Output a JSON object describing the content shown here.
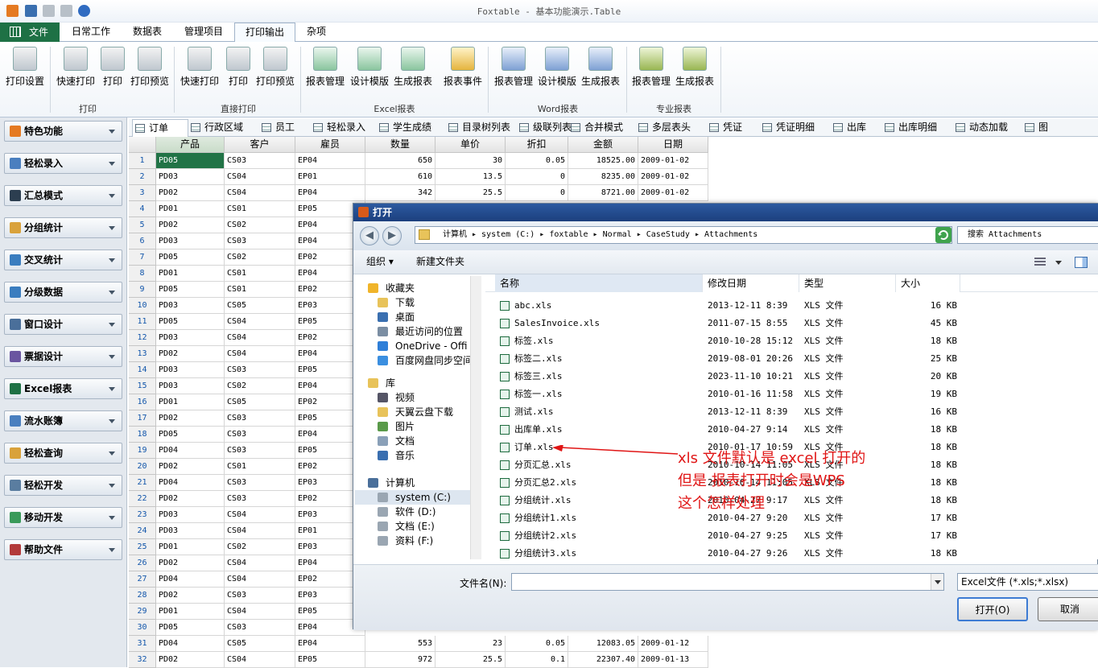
{
  "app": {
    "title": "Foxtable - 基本功能演示.Table"
  },
  "ribbon_tabs": {
    "file": "文件",
    "items": [
      "日常工作",
      "数据表",
      "管理项目",
      "打印输出",
      "杂项"
    ],
    "active": "打印输出"
  },
  "ribbon": {
    "buttons": [
      "打印设置",
      "快速打印",
      "打印",
      "打印预览",
      "快速打印",
      "打印",
      "打印预览",
      "报表管理",
      "设计模版",
      "生成报表",
      "报表事件",
      "报表管理",
      "设计模版",
      "生成报表",
      "报表管理",
      "生成报表"
    ],
    "groups": [
      "打印",
      "直接打印",
      "Excel报表",
      "Word报表",
      "专业报表"
    ]
  },
  "sidebar": {
    "items": [
      "特色功能",
      "轻松录入",
      "汇总模式",
      "分组统计",
      "交叉统计",
      "分级数据",
      "窗口设计",
      "票据设计",
      "Excel报表",
      "流水账簿",
      "轻松查询",
      "轻松开发",
      "移动开发",
      "帮助文件"
    ]
  },
  "doc_tabs": [
    "订单",
    "行政区域",
    "员工",
    "轻松录入",
    "学生成绩",
    "目录树列表",
    "级联列表",
    "合并模式",
    "多层表头",
    "凭证",
    "凭证明细",
    "出库",
    "出库明细",
    "动态加载",
    "图"
  ],
  "grid": {
    "columns": [
      "产品",
      "客户",
      "雇员",
      "数量",
      "单价",
      "折扣",
      "金额",
      "日期"
    ],
    "rows": [
      [
        "1",
        "PD05",
        "CS03",
        "EP04",
        "650",
        "30",
        "0.05",
        "18525.00",
        "2009-01-02"
      ],
      [
        "2",
        "PD03",
        "CS04",
        "EP01",
        "610",
        "13.5",
        "0",
        "8235.00",
        "2009-01-02"
      ],
      [
        "3",
        "PD02",
        "CS04",
        "EP04",
        "342",
        "25.5",
        "0",
        "8721.00",
        "2009-01-02"
      ],
      [
        "4",
        "PD01",
        "CS01",
        "EP05"
      ],
      [
        "5",
        "PD02",
        "CS02",
        "EP04"
      ],
      [
        "6",
        "PD03",
        "CS03",
        "EP04"
      ],
      [
        "7",
        "PD05",
        "CS02",
        "EP02"
      ],
      [
        "8",
        "PD01",
        "CS01",
        "EP04"
      ],
      [
        "9",
        "PD05",
        "CS01",
        "EP02"
      ],
      [
        "10",
        "PD03",
        "CS05",
        "EP03"
      ],
      [
        "11",
        "PD05",
        "CS04",
        "EP05"
      ],
      [
        "12",
        "PD03",
        "CS04",
        "EP02"
      ],
      [
        "13",
        "PD02",
        "CS04",
        "EP04"
      ],
      [
        "14",
        "PD03",
        "CS03",
        "EP05"
      ],
      [
        "15",
        "PD03",
        "CS02",
        "EP04"
      ],
      [
        "16",
        "PD01",
        "CS05",
        "EP02"
      ],
      [
        "17",
        "PD02",
        "CS03",
        "EP05"
      ],
      [
        "18",
        "PD05",
        "CS03",
        "EP04"
      ],
      [
        "19",
        "PD04",
        "CS03",
        "EP05"
      ],
      [
        "20",
        "PD02",
        "CS01",
        "EP02"
      ],
      [
        "21",
        "PD04",
        "CS03",
        "EP03"
      ],
      [
        "22",
        "PD02",
        "CS03",
        "EP02"
      ],
      [
        "23",
        "PD03",
        "CS04",
        "EP03"
      ],
      [
        "24",
        "PD03",
        "CS04",
        "EP01"
      ],
      [
        "25",
        "PD01",
        "CS02",
        "EP03"
      ],
      [
        "26",
        "PD02",
        "CS04",
        "EP04"
      ],
      [
        "27",
        "PD04",
        "CS04",
        "EP02"
      ],
      [
        "28",
        "PD02",
        "CS03",
        "EP03"
      ],
      [
        "29",
        "PD01",
        "CS04",
        "EP05"
      ],
      [
        "30",
        "PD05",
        "CS03",
        "EP04"
      ],
      [
        "31",
        "PD04",
        "CS05",
        "EP04",
        "553",
        "23",
        "0.05",
        "12083.05",
        "2009-01-12"
      ],
      [
        "32",
        "PD02",
        "CS04",
        "EP05",
        "972",
        "25.5",
        "0.1",
        "22307.40",
        "2009-01-13"
      ]
    ]
  },
  "dialog": {
    "title": "打开",
    "address": "计算机 ▸ system (C:) ▸ foxtable ▸ Normal ▸ CaseStudy ▸ Attachments",
    "search_placeholder": "搜索 Attachments",
    "organize": "组织 ▾",
    "new_folder": "新建文件夹",
    "tree": [
      {
        "label": "收藏夹",
        "icon": "star-icon"
      },
      {
        "label": "下载",
        "icon": "download-folder-icon"
      },
      {
        "label": "桌面",
        "icon": "desktop-icon"
      },
      {
        "label": "最近访问的位置",
        "icon": "recent-icon"
      },
      {
        "label": "OneDrive - Offi",
        "icon": "cloud-icon"
      },
      {
        "label": "百度网盘同步空间",
        "icon": "baidu-icon"
      },
      {
        "label": "库",
        "icon": "library-icon"
      },
      {
        "label": "视频",
        "icon": "video-icon"
      },
      {
        "label": "天翼云盘下载",
        "icon": "folder-icon"
      },
      {
        "label": "图片",
        "icon": "picture-icon"
      },
      {
        "label": "文档",
        "icon": "document-icon"
      },
      {
        "label": "音乐",
        "icon": "music-icon"
      },
      {
        "label": "计算机",
        "icon": "computer-icon"
      },
      {
        "label": "system (C:)",
        "icon": "drive-icon"
      },
      {
        "label": "软件 (D:)",
        "icon": "drive-icon"
      },
      {
        "label": "文档 (E:)",
        "icon": "drive-icon"
      },
      {
        "label": "资料 (F:)",
        "icon": "drive-icon"
      }
    ],
    "columns": [
      "名称",
      "修改日期",
      "类型",
      "大小"
    ],
    "files": [
      [
        "abc.xls",
        "2013-12-11 8:39",
        "XLS 文件",
        "16 KB"
      ],
      [
        "SalesInvoice.xls",
        "2011-07-15 8:55",
        "XLS 文件",
        "45 KB"
      ],
      [
        "标签.xls",
        "2010-10-28 15:12",
        "XLS 文件",
        "18 KB"
      ],
      [
        "标签二.xls",
        "2019-08-01 20:26",
        "XLS 文件",
        "25 KB"
      ],
      [
        "标签三.xls",
        "2023-11-10 10:21",
        "XLS 文件",
        "20 KB"
      ],
      [
        "标签一.xls",
        "2010-01-16 11:58",
        "XLS 文件",
        "19 KB"
      ],
      [
        "测试.xls",
        "2013-12-11 8:39",
        "XLS 文件",
        "16 KB"
      ],
      [
        "出库单.xls",
        "2010-04-27 9:14",
        "XLS 文件",
        "18 KB"
      ],
      [
        "订单.xls",
        "2010-01-17 10:59",
        "XLS 文件",
        "18 KB"
      ],
      [
        "分页汇总.xls",
        "2010-10-14 11:05",
        "XLS 文件",
        "18 KB"
      ],
      [
        "分页汇总2.xls",
        "2010-10-14 11:05",
        "XLS 文件",
        "18 KB"
      ],
      [
        "分组统计.xls",
        "2010-04-27 9:17",
        "XLS 文件",
        "18 KB"
      ],
      [
        "分组统计1.xls",
        "2010-04-27 9:20",
        "XLS 文件",
        "17 KB"
      ],
      [
        "分组统计2.xls",
        "2010-04-27 9:25",
        "XLS 文件",
        "17 KB"
      ],
      [
        "分组统计3.xls",
        "2010-04-27 9:26",
        "XLS 文件",
        "18 KB"
      ]
    ],
    "filename_label": "文件名(N):",
    "filename_value": "",
    "filter": "Excel文件 (*.xls;*.xlsx)",
    "open_button": "打开(O)",
    "cancel_button": "取消"
  },
  "annotation": {
    "line1": "xls 文件默认是  excel 打开的",
    "line2": "但是 报表打开时会是WPS",
    "line3": "这个怎样处理",
    "color": "#e01515"
  }
}
